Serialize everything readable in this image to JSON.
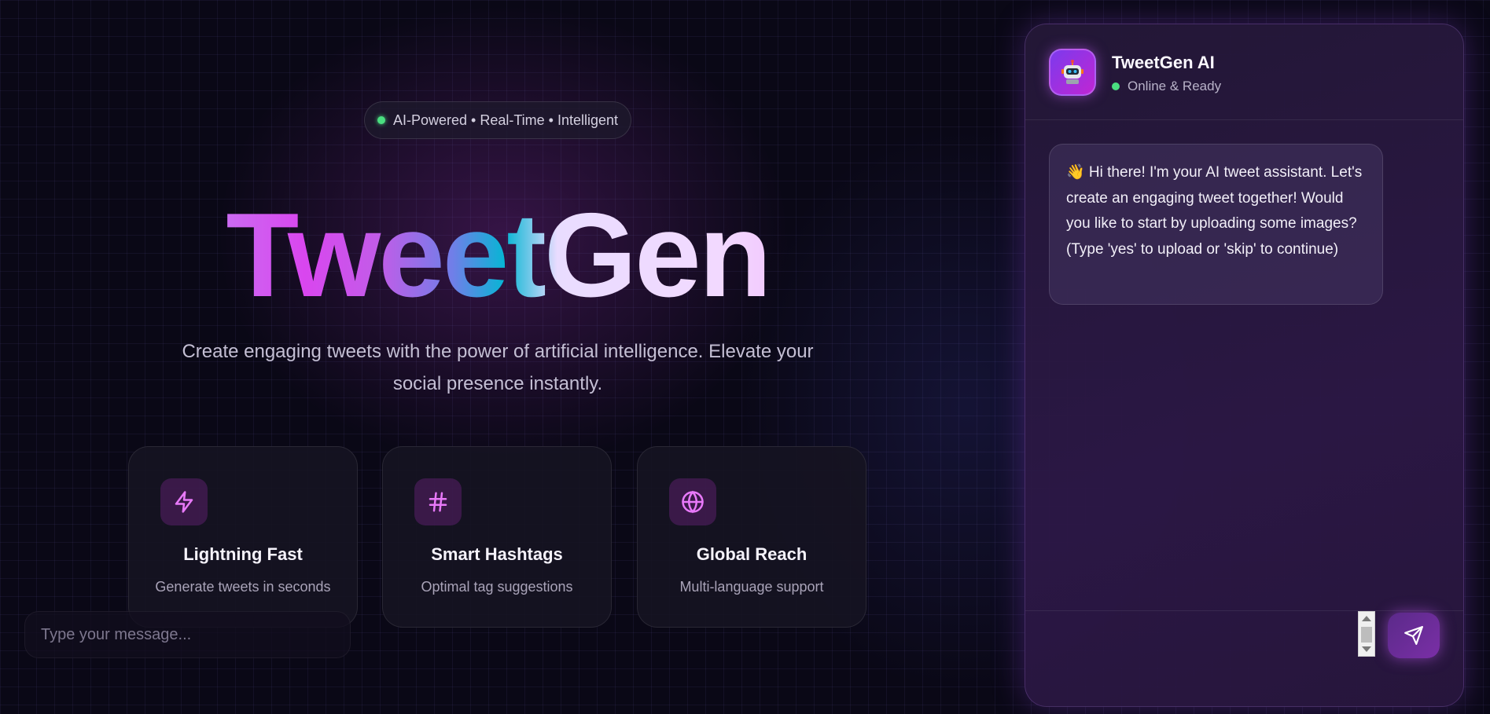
{
  "hero": {
    "badge_text": "AI-Powered • Real-Time • Intelligent",
    "title": "TweetGen",
    "subtitle_line1": "Create engaging tweets with the power of artificial intelligence. Elevate your",
    "subtitle_line2": "social presence instantly."
  },
  "features": [
    {
      "icon": "lightning-icon",
      "title": "Lightning Fast",
      "description": "Generate tweets in seconds"
    },
    {
      "icon": "hashtag-icon",
      "title": "Smart Hashtags",
      "description": "Optimal tag suggestions"
    },
    {
      "icon": "globe-icon",
      "title": "Global Reach",
      "description": "Multi-language support"
    }
  ],
  "chat": {
    "bot_name": "TweetGen AI",
    "status": "Online & Ready",
    "avatar_icon": "robot-icon",
    "messages": [
      {
        "sender": "bot",
        "text": "👋 Hi there! I'm your AI tweet assistant. Let's create an engaging tweet together! Would you like to start by uploading some images? (Type 'yes' to upload or 'skip' to continue)"
      }
    ],
    "input_placeholder": "Type your message...",
    "input_value": "",
    "send_icon": "send-icon"
  },
  "colors": {
    "background": "#0a0816",
    "accent_purple": "#d946ef",
    "accent_cyan": "#06b6d4",
    "status_green": "#4ade80"
  }
}
